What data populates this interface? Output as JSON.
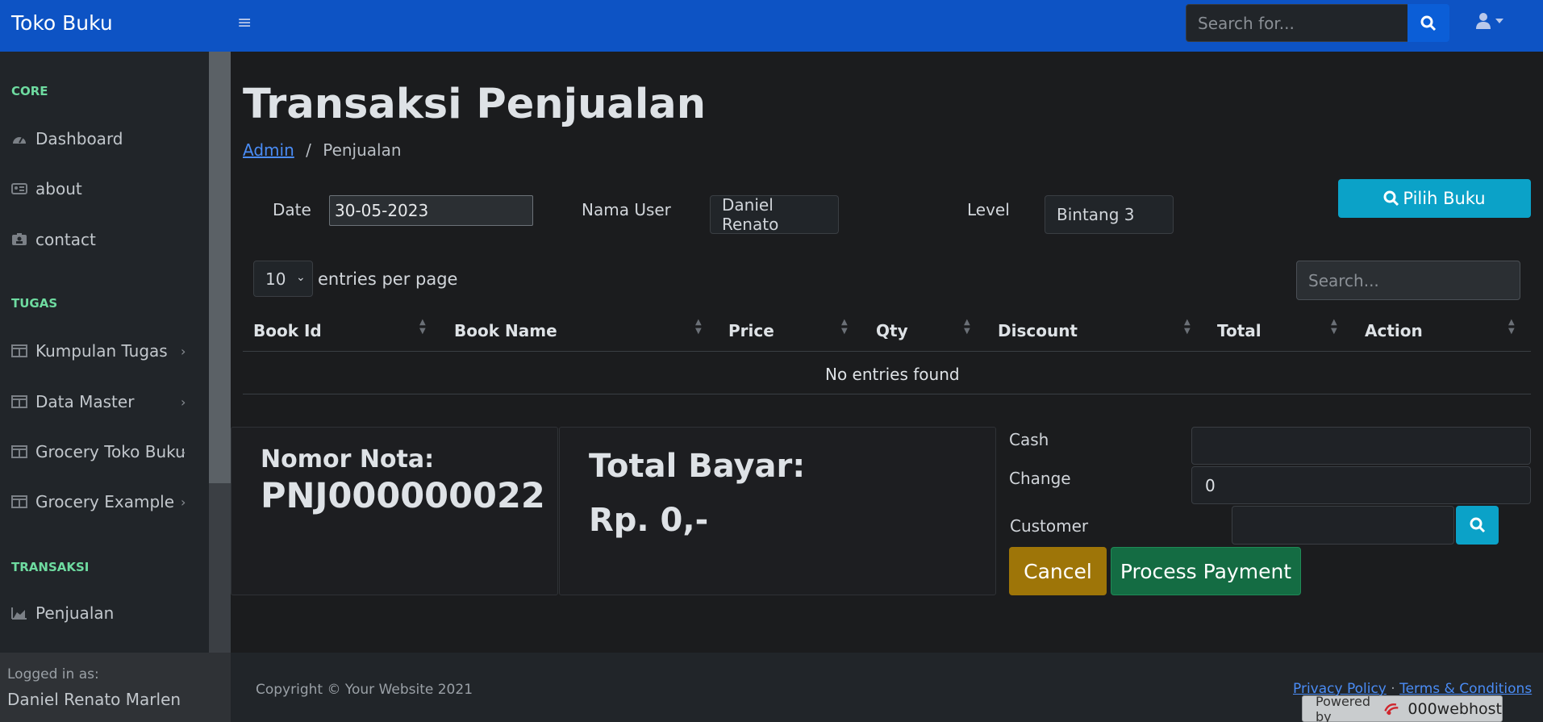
{
  "topbar": {
    "brand": "Toko Buku",
    "search_placeholder": "Search for...",
    "toggle_icon": "bars-icon",
    "search_icon": "search-icon",
    "user_icon": "user-icon"
  },
  "sidebar": {
    "sections": [
      {
        "heading": "CORE",
        "items": [
          {
            "label": "Dashboard",
            "icon": "tachometer-icon",
            "chevron": false
          },
          {
            "label": "about",
            "icon": "id-card-icon",
            "chevron": false
          },
          {
            "label": "contact",
            "icon": "id-badge-icon",
            "chevron": false
          }
        ]
      },
      {
        "heading": "TUGAS",
        "items": [
          {
            "label": "Kumpulan Tugas",
            "icon": "columns-icon",
            "chevron": true
          },
          {
            "label": "Data Master",
            "icon": "columns-icon",
            "chevron": true
          },
          {
            "label": "Grocery Toko Buku",
            "icon": "columns-icon",
            "chevron": true
          },
          {
            "label": "Grocery Example",
            "icon": "columns-icon",
            "chevron": true
          }
        ]
      },
      {
        "heading": "TRANSAKSI",
        "items": [
          {
            "label": "Penjualan",
            "icon": "chart-area-icon",
            "chevron": false
          }
        ]
      }
    ],
    "footer": {
      "logged_in_label": "Logged in as:",
      "user_name": "Daniel Renato Marlen"
    }
  },
  "page": {
    "title": "Transaksi Penjualan",
    "breadcrumb": {
      "link": "Admin",
      "separator": "/",
      "current": "Penjualan"
    }
  },
  "form": {
    "date_label": "Date",
    "date_value": "30-05-2023",
    "user_label": "Nama User",
    "user_value": "Daniel Renato",
    "level_label": "Level",
    "level_value": "Bintang 3",
    "pick_book_button": "Pilih Buku"
  },
  "table": {
    "per_page_value": "10",
    "per_page_label": "entries per page",
    "search_placeholder": "Search...",
    "columns": [
      "Book Id",
      "Book Name",
      "Price",
      "Qty",
      "Discount",
      "Total",
      "Action"
    ],
    "empty_text": "No entries found"
  },
  "invoice": {
    "nota_label": "Nomor Nota:",
    "nota_value": "PNJ000000022",
    "total_label": "Total Bayar:",
    "total_value": "Rp. 0,-"
  },
  "payment": {
    "cash_label": "Cash",
    "cash_value": "",
    "change_label": "Change",
    "change_value": "0",
    "customer_label": "Customer",
    "customer_value": "",
    "cancel_button": "Cancel",
    "process_button": "Process Payment"
  },
  "footer": {
    "copyright": "Copyright © Your Website 2021",
    "privacy": "Privacy Policy",
    "separator": "·",
    "terms": "Terms & Conditions",
    "powered_by": "Powered by",
    "host": "000webhost"
  },
  "colors": {
    "topbar": "#0d53c4",
    "accent_info": "#0ba2c8",
    "warning": "#9e7508",
    "success": "#146c43",
    "sidebar_heading": "#6edba0"
  }
}
